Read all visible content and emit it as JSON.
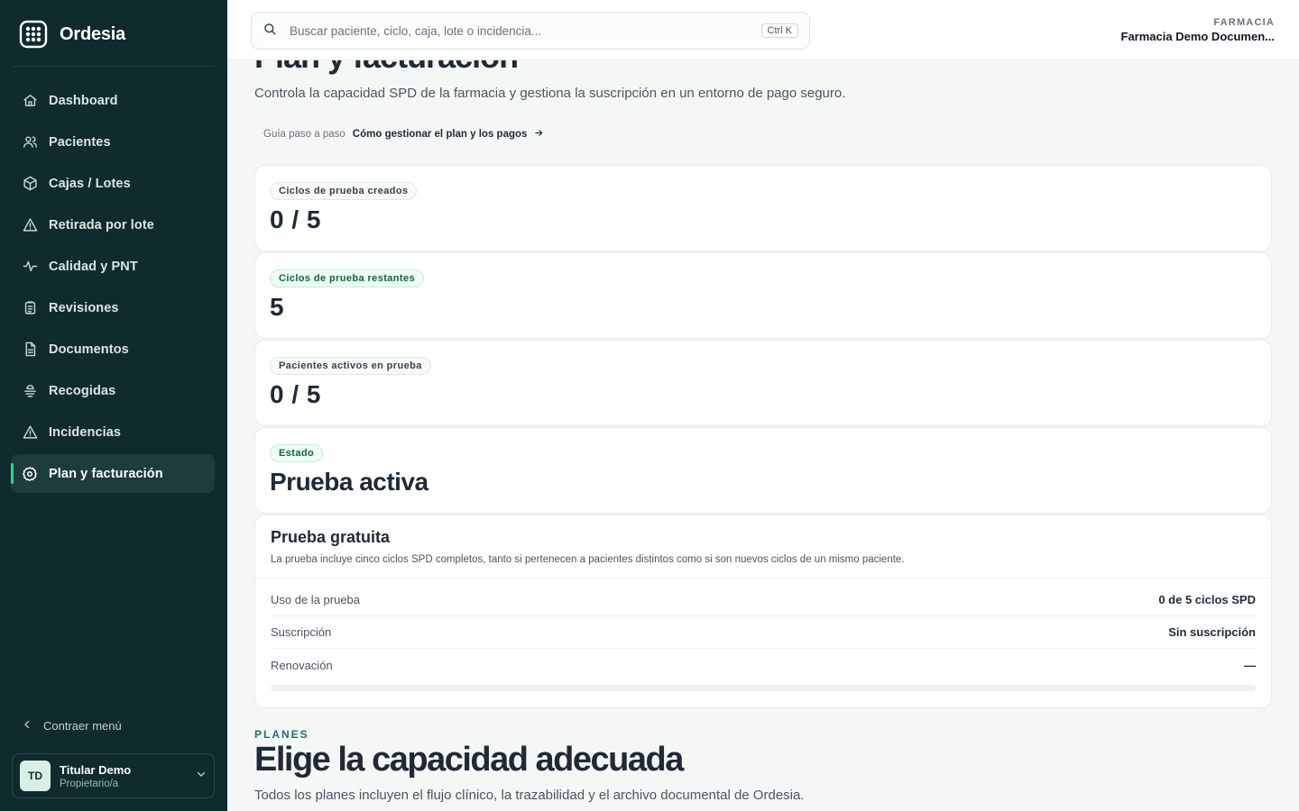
{
  "brand": {
    "name": "Ordesia"
  },
  "sidebar": {
    "items": [
      {
        "label": "Dashboard",
        "icon": "home-icon"
      },
      {
        "label": "Pacientes",
        "icon": "users-icon"
      },
      {
        "label": "Cajas / Lotes",
        "icon": "box-icon"
      },
      {
        "label": "Retirada por lote",
        "icon": "warning-icon"
      },
      {
        "label": "Calidad y PNT",
        "icon": "activity-icon"
      },
      {
        "label": "Revisiones",
        "icon": "clipboard-icon"
      },
      {
        "label": "Documentos",
        "icon": "document-icon"
      },
      {
        "label": "Recogidas",
        "icon": "pickup-icon"
      },
      {
        "label": "Incidencias",
        "icon": "alert-icon"
      },
      {
        "label": "Plan y facturación",
        "icon": "settings-icon",
        "active": true
      }
    ],
    "collapse_label": "Contraer menú",
    "user": {
      "initials": "TD",
      "name": "Titular Demo",
      "role": "Propietario/a"
    }
  },
  "topbar": {
    "search_placeholder": "Buscar paciente, ciclo, caja, lote o incidencia...",
    "shortcut": "Ctrl K",
    "pharmacy_label": "FARMACIA",
    "pharmacy_name": "Farmacia Demo Documen..."
  },
  "main": {
    "title": "Plan y facturación",
    "subtitle": "Controla la capacidad SPD de la farmacia y gestiona la suscripción en un entorno de pago seguro.",
    "guide_label": "Guía paso a paso",
    "guide_link": "Cómo gestionar el plan y los pagos",
    "stats": [
      {
        "label": "Ciclos de prueba creados",
        "value": "0 / 5",
        "green": false
      },
      {
        "label": "Ciclos de prueba restantes",
        "value": "5",
        "green": true
      },
      {
        "label": "Pacientes activos en prueba",
        "value": "0 / 5",
        "green": false
      },
      {
        "label": "Estado",
        "value": "Prueba activa",
        "green": true
      }
    ],
    "trial": {
      "title": "Prueba gratuita",
      "description": "La prueba incluye cinco ciclos SPD completos, tanto si pertenecen a pacientes distintos como si son nuevos ciclos de un mismo paciente.",
      "rows": [
        {
          "key": "Uso de la prueba",
          "value": "0 de 5 ciclos SPD"
        },
        {
          "key": "Suscripción",
          "value": "Sin suscripción"
        },
        {
          "key": "Renovación",
          "value": "—"
        }
      ],
      "progress": 0
    },
    "plans": {
      "label": "PLANES",
      "title": "Elige la capacidad adecuada",
      "subtitle": "Todos los planes incluyen el flujo clínico, la trazabilidad y el archivo documental de Ordesia."
    }
  },
  "colors": {
    "sidebar_bg": "#0f2b2d",
    "accent": "#34d399",
    "success_pill": "#ecfdf3"
  }
}
